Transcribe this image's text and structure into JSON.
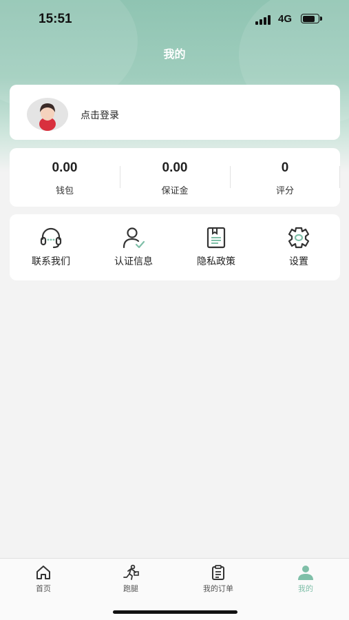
{
  "status_bar": {
    "time": "15:51",
    "network": "4G"
  },
  "header": {
    "title": "我的"
  },
  "profile": {
    "login_label": "点击登录"
  },
  "stats": [
    {
      "value": "0.00",
      "label": "钱包"
    },
    {
      "value": "0.00",
      "label": "保证金"
    },
    {
      "value": "0",
      "label": "评分"
    }
  ],
  "menu": [
    {
      "label": "联系我们",
      "icon": "headset-icon"
    },
    {
      "label": "认证信息",
      "icon": "user-verified-icon"
    },
    {
      "label": "隐私政策",
      "icon": "document-icon"
    },
    {
      "label": "设置",
      "icon": "gear-icon"
    }
  ],
  "tab_bar": {
    "items": [
      {
        "label": "首页",
        "icon": "home-icon"
      },
      {
        "label": "跑腿",
        "icon": "runner-icon"
      },
      {
        "label": "我的订单",
        "icon": "clipboard-icon"
      },
      {
        "label": "我的",
        "icon": "person-icon"
      }
    ],
    "active": "我的"
  },
  "colors": {
    "accent": "#7fbfa8",
    "header": "#9fcdbd",
    "background": "#f3f3f3"
  }
}
